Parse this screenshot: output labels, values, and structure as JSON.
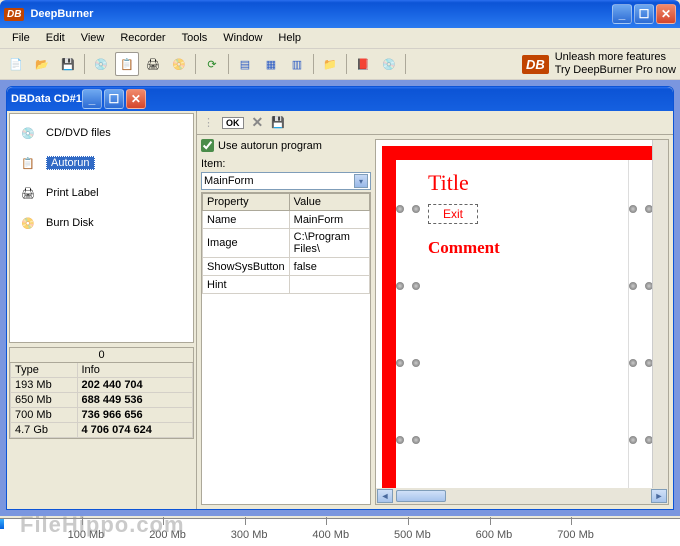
{
  "app": {
    "title": "DeepBurner"
  },
  "menu": [
    "File",
    "Edit",
    "View",
    "Recorder",
    "Tools",
    "Window",
    "Help"
  ],
  "promo": {
    "line1": "Unleash more features",
    "line2": "Try DeepBurner Pro now"
  },
  "child": {
    "title": "Data CD#1"
  },
  "nav": [
    {
      "label": "CD/DVD files"
    },
    {
      "label": "Autorun"
    },
    {
      "label": "Print Label"
    },
    {
      "label": "Burn Disk"
    }
  ],
  "info": {
    "header": "0",
    "cols": [
      "Type",
      "Info"
    ],
    "rows": [
      [
        "193 Mb",
        "202 440 704"
      ],
      [
        "650 Mb",
        "688 449 536"
      ],
      [
        "700 Mb",
        "736 966 656"
      ],
      [
        "4.7 Gb",
        "4 706 074 624"
      ]
    ]
  },
  "autorun": {
    "checkbox": "Use autorun program",
    "item_label": "Item:",
    "item_value": "MainForm",
    "prop_cols": [
      "Property",
      "Value"
    ],
    "props": [
      [
        "Name",
        "MainForm"
      ],
      [
        "Image",
        "C:\\Program Files\\"
      ],
      [
        "ShowSysButton",
        "false"
      ],
      [
        "Hint",
        ""
      ]
    ]
  },
  "preview": {
    "title": "Title",
    "exit": "Exit",
    "comment": "Comment"
  },
  "ruler": [
    "100 Mb",
    "200 Mb",
    "300 Mb",
    "400 Mb",
    "500 Mb",
    "600 Mb",
    "700 Mb"
  ],
  "watermark": "FileHippo.com"
}
